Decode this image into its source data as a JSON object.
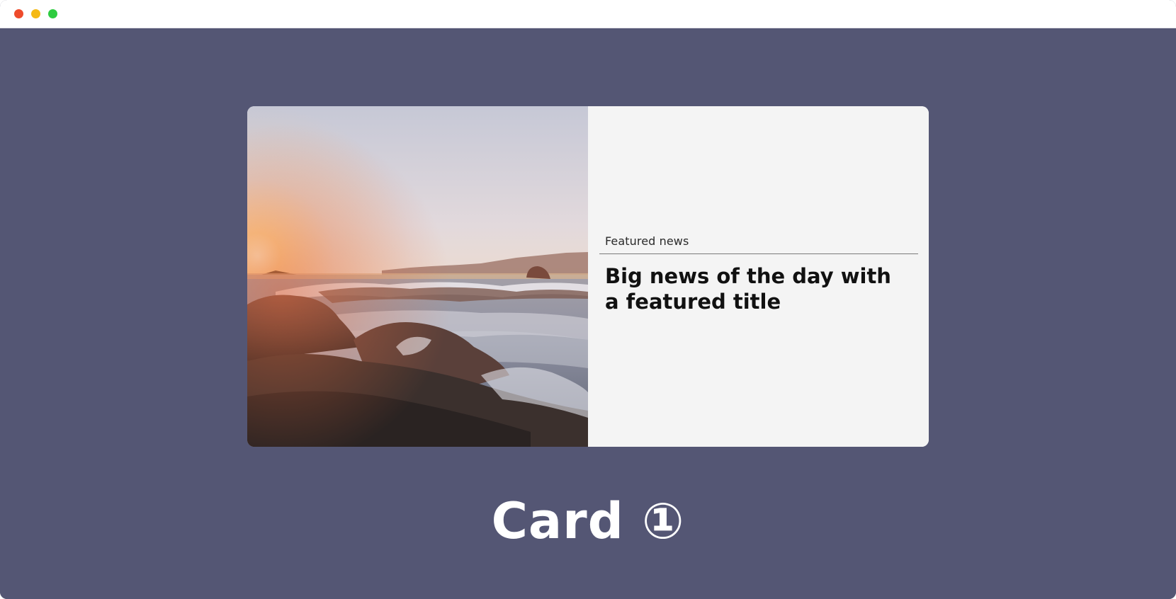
{
  "window": {
    "controls": [
      "close",
      "minimize",
      "maximize"
    ]
  },
  "card": {
    "image_description_icon": "photo-seascape-sunset",
    "eyebrow": "Featured news",
    "title": "Big news of the day with a featured title"
  },
  "caption": {
    "text": "Card ①"
  },
  "colors": {
    "background": "#545674",
    "card_body": "#f4f4f4",
    "close": "#ee4b2b",
    "minimize": "#f5b914",
    "maximize": "#2ecc40"
  }
}
